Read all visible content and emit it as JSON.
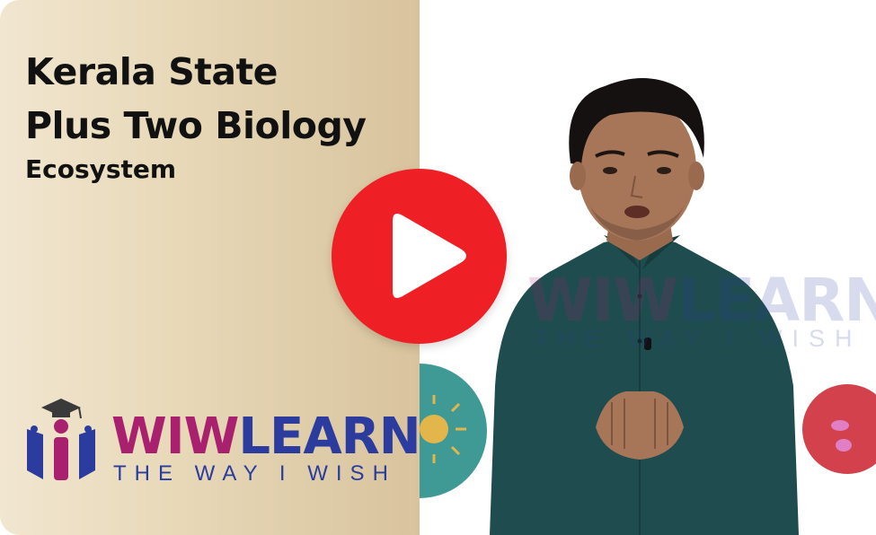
{
  "course": {
    "title_lines": [
      "Kerala State",
      "Plus Two Biology"
    ],
    "subtitle": "Ecosystem"
  },
  "brand": {
    "name_part1": "WIW",
    "name_part2": "LEARN",
    "tagline": "THE WAY I WISH",
    "colors": {
      "magenta": "#a8206e",
      "navy": "#2b3c9e",
      "play_red": "#ee1f25",
      "panel_beige": "#e8d9b9"
    }
  },
  "player": {
    "play_icon": "play-icon"
  }
}
